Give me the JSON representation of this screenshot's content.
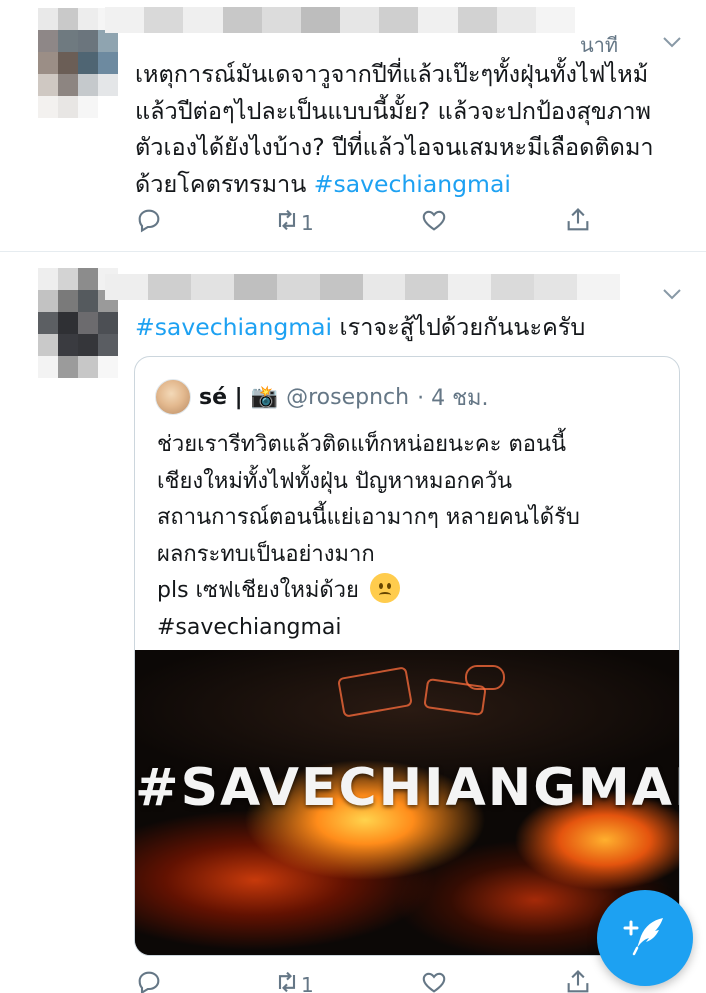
{
  "tweets": [
    {
      "time": "นาที",
      "text_lines": [
        "เหตุการณ์มันเดจาวูจากปีที่แล้วเป๊ะๆทั้งฝุ่นทั้งไฟไหม้",
        "แล้วปีต่อๆไปละเป็นแบบนี้มั้ย? แล้วจะปกป้องสุขภาพ",
        "ตัวเองได้ยังไงบ้าง? ปีที่แล้วไอจนเสมหะมีเลือดติดมา"
      ],
      "text_last": "ด้วยโคตรทรมาน ",
      "hashtag": "#savechiangmai",
      "actions": {
        "reply_count": "",
        "retweet_count": "1",
        "like_count": ""
      }
    },
    {
      "hashtag": "#savechiangmai",
      "text": " เราจะสู้ไปด้วยกันนะครับ",
      "quote": {
        "name": "sé |",
        "camera_emoji": "📸",
        "handle": "@rosepnch",
        "time": "· 4 ชม.",
        "text_lines": [
          "ช่วยเรารีทวิตแล้วติดแท็กหน่อยนะคะ ตอนนี้",
          "เชียงใหม่ทั้งไฟทั้งฝุ่น ปัญหาหมอกควัน",
          "สถานการณ์ตอนนี้แย่เอามากๆ หลายคนได้รับ",
          "ผลกระทบเป็นอย่างมาก"
        ],
        "pls_line": " pls เซฟเชียงใหม่ด้วย",
        "hashtag_line": "#savechiangmai",
        "image_text": "#SAVECHIANGMAI"
      },
      "actions": {
        "reply_count": "",
        "retweet_count": "1",
        "like_count": ""
      }
    }
  ],
  "colors": {
    "accent": "#1da1f2",
    "secondary_text": "#657786",
    "divider": "#e6ecf0"
  },
  "icons": {
    "reply": "reply-icon",
    "retweet": "retweet-icon",
    "like": "heart-icon",
    "share": "share-icon",
    "more": "chevron-down-icon",
    "compose": "compose-tweet-icon"
  }
}
